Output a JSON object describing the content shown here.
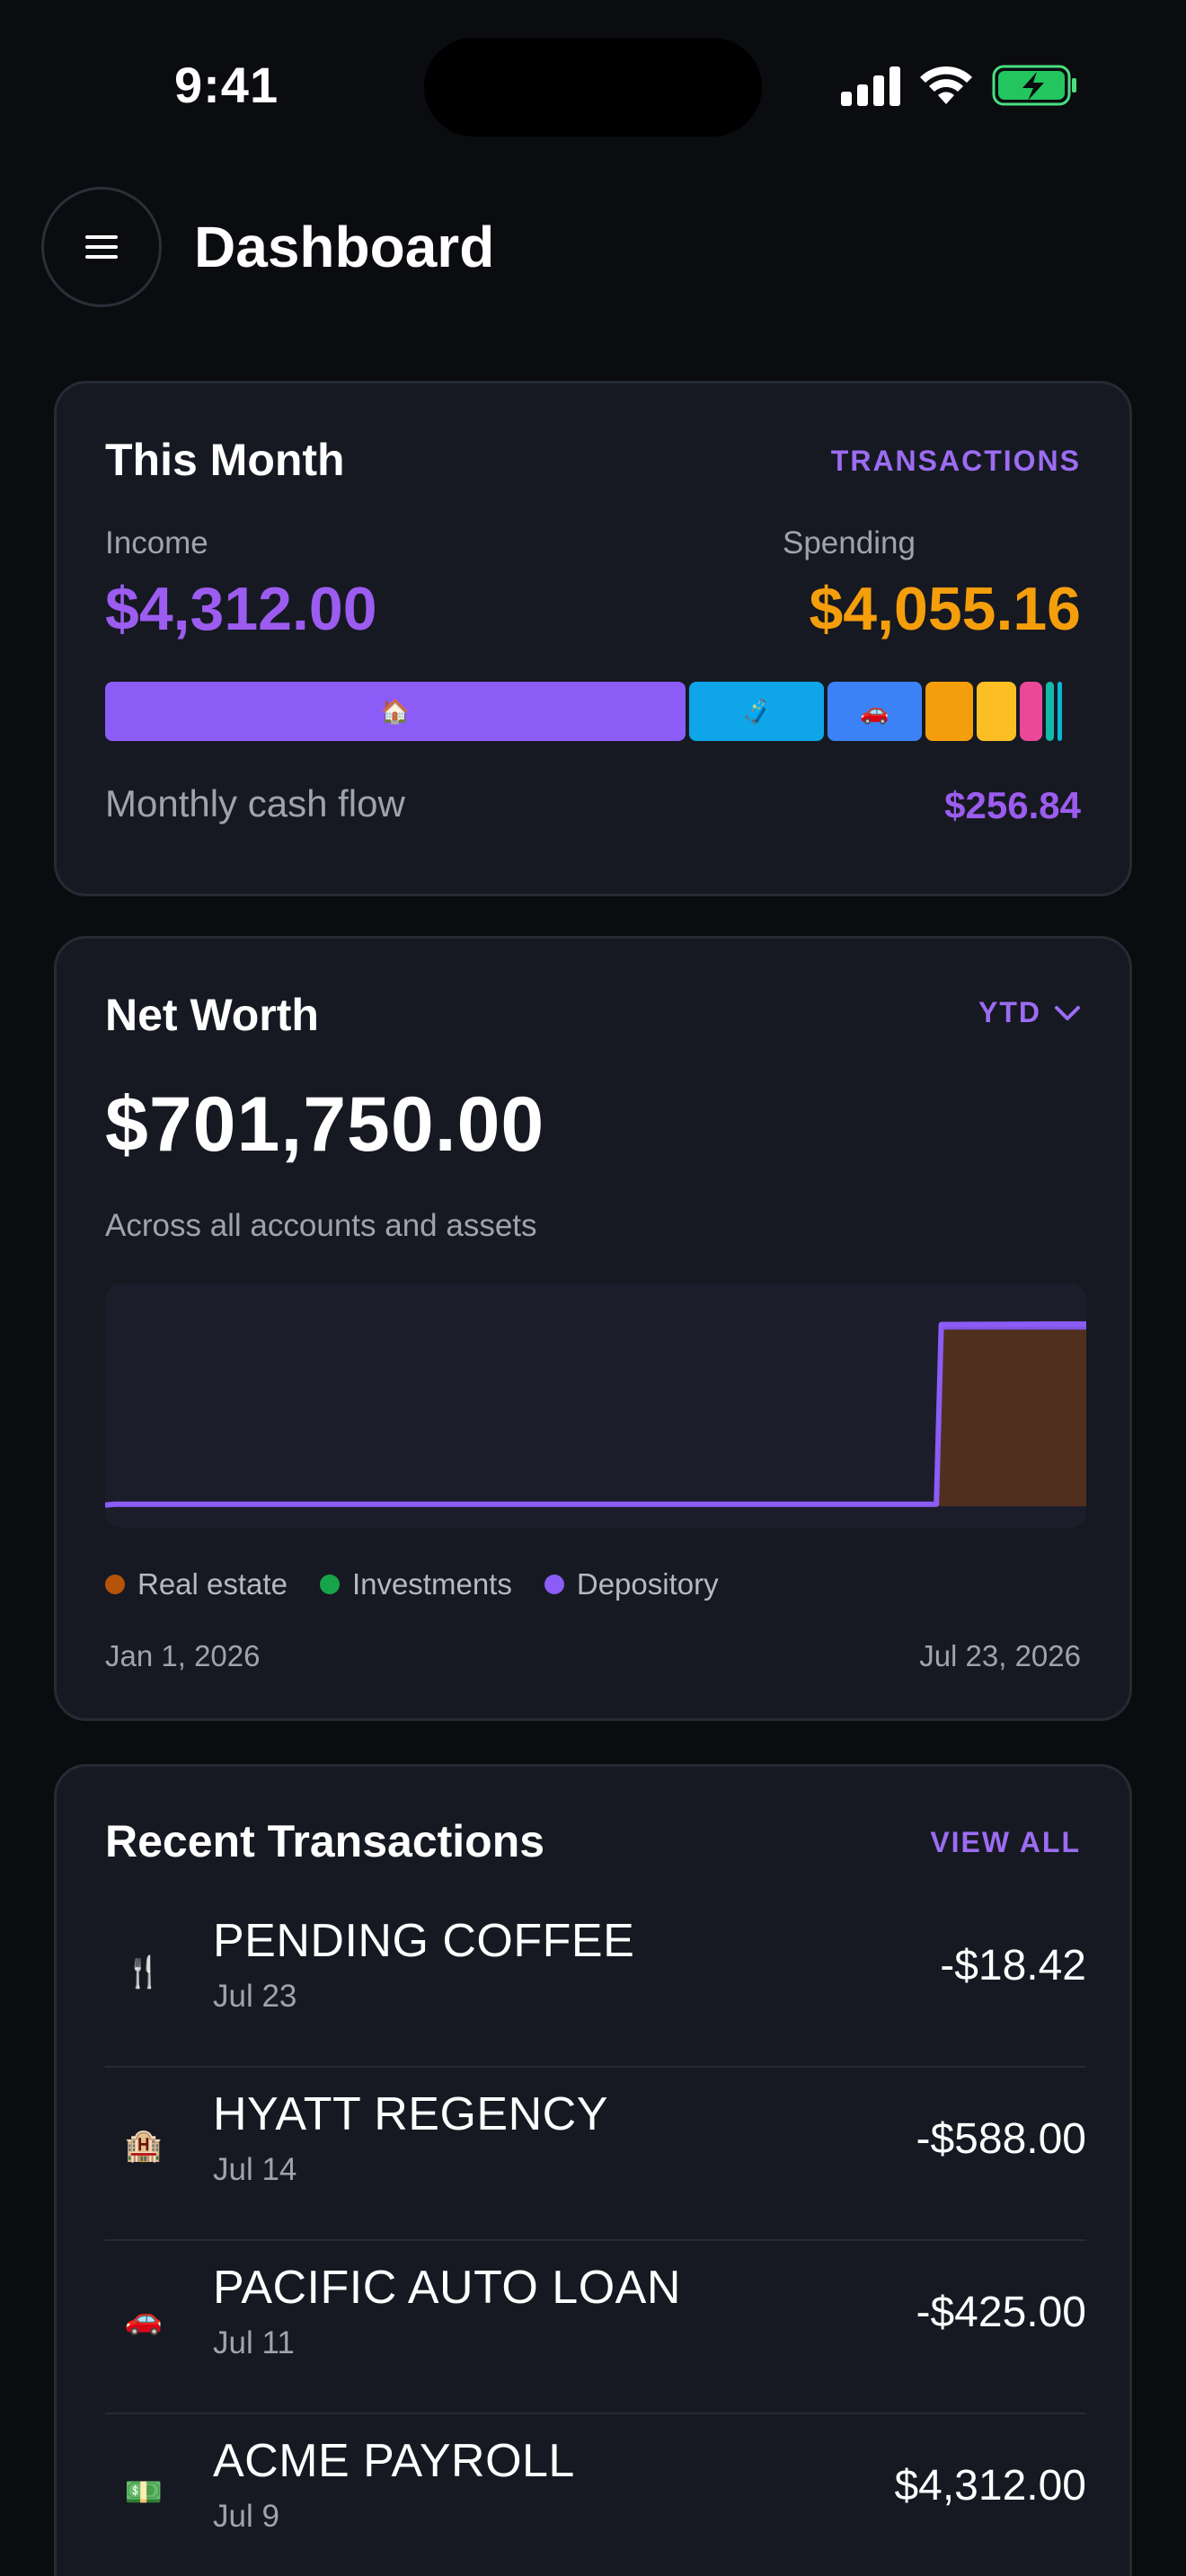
{
  "status_bar": {
    "time": "9:41"
  },
  "header": {
    "title": "Dashboard",
    "menu_icon": "hamburger-menu-icon"
  },
  "this_month": {
    "title": "This Month",
    "link_label": "TRANSACTIONS",
    "income_label": "Income",
    "income_value": "$4,312.00",
    "spending_label": "Spending",
    "spending_value": "$4,055.16",
    "cashflow_label": "Monthly cash flow",
    "cashflow_value": "$256.84",
    "categories": [
      {
        "name": "housing",
        "icon": "🏠",
        "share": 0.595,
        "color": "#8b5cf6"
      },
      {
        "name": "travel",
        "icon": "🧳",
        "share": 0.141,
        "color": "#0ea5e9"
      },
      {
        "name": "auto",
        "icon": "🚗",
        "share": 0.1,
        "color": "#3b82f6"
      },
      {
        "name": "other-1",
        "icon": "",
        "share": 0.052,
        "color": "#f59e0b"
      },
      {
        "name": "other-2",
        "icon": "",
        "share": 0.044,
        "color": "#fbbf24"
      },
      {
        "name": "other-3",
        "icon": "",
        "share": 0.027,
        "color": "#ec4899"
      },
      {
        "name": "other-4",
        "icon": "",
        "share": 0.012,
        "color": "#14b8a6"
      },
      {
        "name": "other-5",
        "icon": "",
        "share": 0.008,
        "color": "#06b6d4"
      }
    ]
  },
  "net_worth": {
    "title": "Net Worth",
    "range_label": "YTD",
    "value": "$701,750.00",
    "subtitle": "Across all accounts and assets",
    "legend": [
      {
        "label": "Real estate",
        "color": "#b45309"
      },
      {
        "label": "Investments",
        "color": "#16a34a"
      },
      {
        "label": "Depository",
        "color": "#8b5cf6"
      }
    ],
    "date_start": "Jan 1, 2026",
    "date_end": "Jul 23, 2026"
  },
  "chart_data": {
    "type": "area",
    "x": [
      "Jan 1, 2026",
      "Jan 3, 2026",
      "Jun 22, 2026",
      "Jun 23, 2026",
      "Jul 15, 2026",
      "Jul 23, 2026"
    ],
    "series": [
      {
        "name": "Real estate",
        "color": "#b45309",
        "values": [
          0,
          0,
          0,
          680000,
          680000,
          680000
        ]
      },
      {
        "name": "Investments",
        "color": "#16a34a",
        "values": [
          0,
          0,
          0,
          0,
          0,
          0
        ]
      },
      {
        "name": "Depository",
        "color": "#8b5cf6",
        "values": [
          5000,
          8000,
          8000,
          20000,
          21500,
          21750
        ]
      }
    ],
    "ylim": [
      0,
      740000
    ]
  },
  "transactions": {
    "title": "Recent Transactions",
    "link_label": "VIEW ALL",
    "items": [
      {
        "icon": "🍴",
        "icon_name": "fork-knife-icon",
        "name": "PENDING COFFEE",
        "date": "Jul 23",
        "amount": "-$18.42"
      },
      {
        "icon": "🏨",
        "icon_name": "hotel-icon",
        "name": "HYATT REGENCY",
        "date": "Jul 14",
        "amount": "-$588.00"
      },
      {
        "icon": "🚗",
        "icon_name": "car-icon",
        "name": "PACIFIC AUTO LOAN",
        "date": "Jul 11",
        "amount": "-$425.00"
      },
      {
        "icon": "💵",
        "icon_name": "cash-icon",
        "name": "ACME PAYROLL",
        "date": "Jul 9",
        "amount": "$4,312.00"
      }
    ]
  }
}
